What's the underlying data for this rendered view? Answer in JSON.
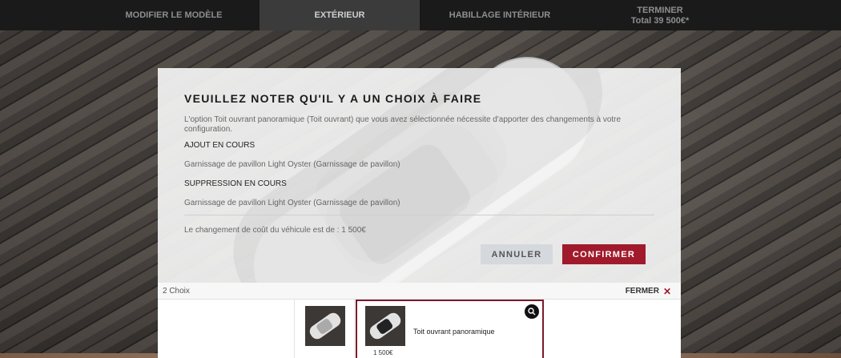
{
  "nav": {
    "tabs": [
      {
        "label": "MODIFIER LE MODÈLE",
        "sub": ""
      },
      {
        "label": "EXTÉRIEUR",
        "sub": ""
      },
      {
        "label": "HABILLAGE INTÉRIEUR",
        "sub": ""
      },
      {
        "label": "TERMINER",
        "sub": "Total 39 500€*"
      }
    ],
    "active_tab": "EXTÉRIEUR"
  },
  "modal": {
    "title": "VEUILLEZ NOTER QU'IL Y A UN CHOIX À FAIRE",
    "description": "L'option Toit ouvrant panoramique (Toit ouvrant) que vous avez sélectionnée nécessite d'apporter des changements à votre configuration.",
    "adding_title": "AJOUT EN COURS",
    "adding_item": "Garnissage de pavillon Light Oyster (Garnissage de pavillon)",
    "removing_title": "SUPPRESSION EN COURS",
    "removing_item": "Garnissage de pavillon Light Oyster (Garnissage de pavillon)",
    "cost_text": "Le changement de coût du véhicule est de : 1 500€",
    "cancel_label": "ANNULER",
    "confirm_label": "CONFIRMER"
  },
  "choices": {
    "count_label": "2 Choix",
    "close_label": "FERMER",
    "items": [
      {
        "name": "",
        "price": "",
        "icon": "car-top-view"
      },
      {
        "name": "Toit ouvrant panoramique",
        "price": "1 500€",
        "icon": "car-top-view-panoramic-roof"
      }
    ]
  },
  "colors": {
    "accent": "#a01a2c",
    "nav_bg": "#1a1a1a",
    "nav_active": "#3b3b3b",
    "cancel_bg": "#d5d8dc"
  }
}
